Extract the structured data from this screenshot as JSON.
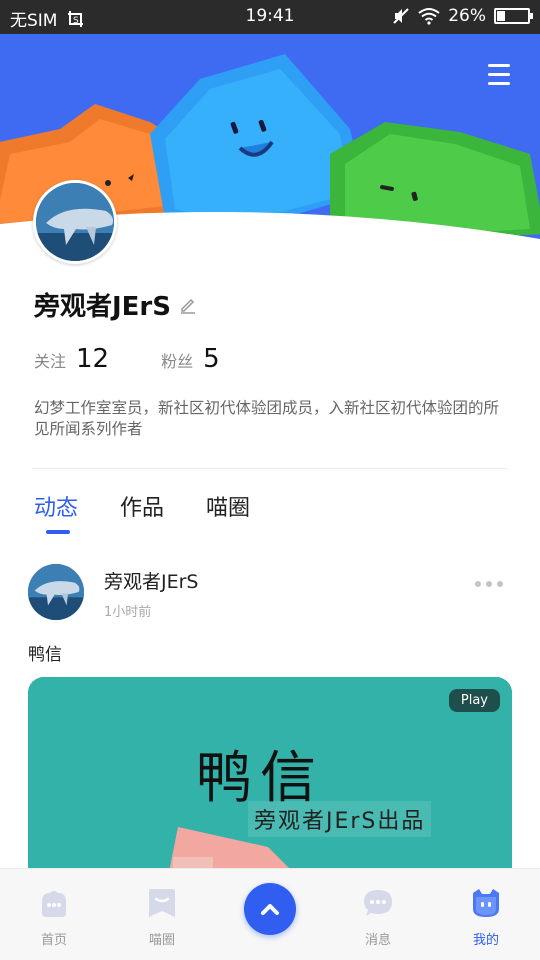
{
  "status_bar": {
    "carrier": "无SIM",
    "time": "19:41",
    "battery_percent": "26%",
    "battery_level": 0.26
  },
  "profile": {
    "name": "旁观者JErS",
    "stats": [
      {
        "label": "关注",
        "value": "12"
      },
      {
        "label": "粉丝",
        "value": "5"
      }
    ],
    "bio": "幻梦工作室室员，新社区初代体验团成员，入新社区初代体验团的所见所闻系列作者"
  },
  "tabs": [
    {
      "label": "动态",
      "active": true
    },
    {
      "label": "作品",
      "active": false
    },
    {
      "label": "喵圈",
      "active": false
    }
  ],
  "post": {
    "author": "旁观者JErS",
    "time": "1小时前",
    "text": "鸭信",
    "media": {
      "badge": "Play",
      "title": "鸭信",
      "subtitle": "旁观者JErS出品"
    }
  },
  "bottom_nav": [
    {
      "label": "首页",
      "icon": "home-icon",
      "active": false
    },
    {
      "label": "喵圈",
      "icon": "circle-icon",
      "active": false
    },
    {
      "label": "",
      "icon": "create-icon",
      "active": false
    },
    {
      "label": "消息",
      "icon": "message-icon",
      "active": false
    },
    {
      "label": "我的",
      "icon": "profile-icon",
      "active": true
    }
  ],
  "colors": {
    "accent": "#2f5ef0",
    "banner": "#3f6bf2",
    "media_bg": "#32b2a9"
  }
}
